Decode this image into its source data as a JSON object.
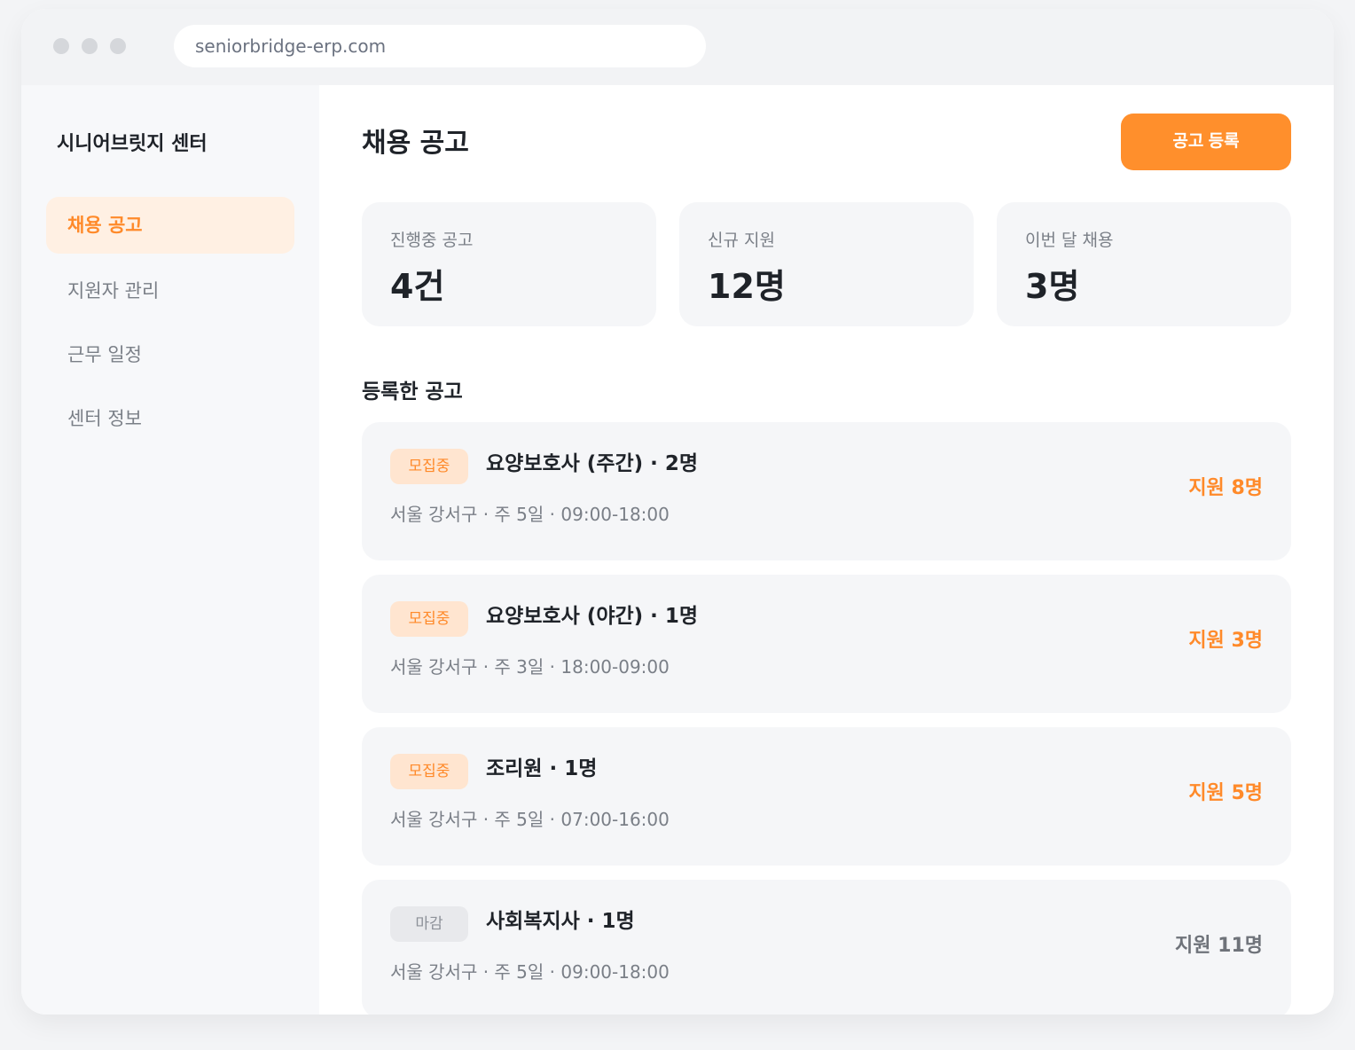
{
  "browser": {
    "url": "seniorbridge-erp.com"
  },
  "sidebar": {
    "brand": "시니어브릿지 센터",
    "items": [
      {
        "label": "채용 공고",
        "active": true
      },
      {
        "label": "지원자 관리",
        "active": false
      },
      {
        "label": "근무 일정",
        "active": false
      },
      {
        "label": "센터 정보",
        "active": false
      }
    ]
  },
  "header": {
    "title": "채용 공고",
    "primary_action": "공고 등록"
  },
  "stats": [
    {
      "label": "진행중 공고",
      "value": "4건"
    },
    {
      "label": "신규 지원",
      "value": "12명"
    },
    {
      "label": "이번 달 채용",
      "value": "3명"
    }
  ],
  "jobs_section": {
    "title": "등록한 공고",
    "jobs": [
      {
        "status": "모집중",
        "title": "요양보호사 (주간) · 2명",
        "meta": "서울 강서구 · 주 5일 · 09:00-18:00",
        "applicants": "지원 8명"
      },
      {
        "status": "모집중",
        "title": "요양보호사 (야간) · 1명",
        "meta": "서울 강서구 · 주 3일 · 18:00-09:00",
        "applicants": "지원 3명"
      },
      {
        "status": "모집중",
        "title": "조리원 · 1명",
        "meta": "서울 강서구 · 주 5일 · 07:00-16:00",
        "applicants": "지원 5명"
      },
      {
        "status": "마감",
        "title": "사회복지사 · 1명",
        "meta": "서울 강서구 · 주 5일 · 09:00-18:00",
        "applicants": "지원 11명"
      }
    ]
  },
  "colors": {
    "accent": "#ff8f2c",
    "accent_soft": "#fff0e3",
    "closed_text": "#6f737a"
  }
}
